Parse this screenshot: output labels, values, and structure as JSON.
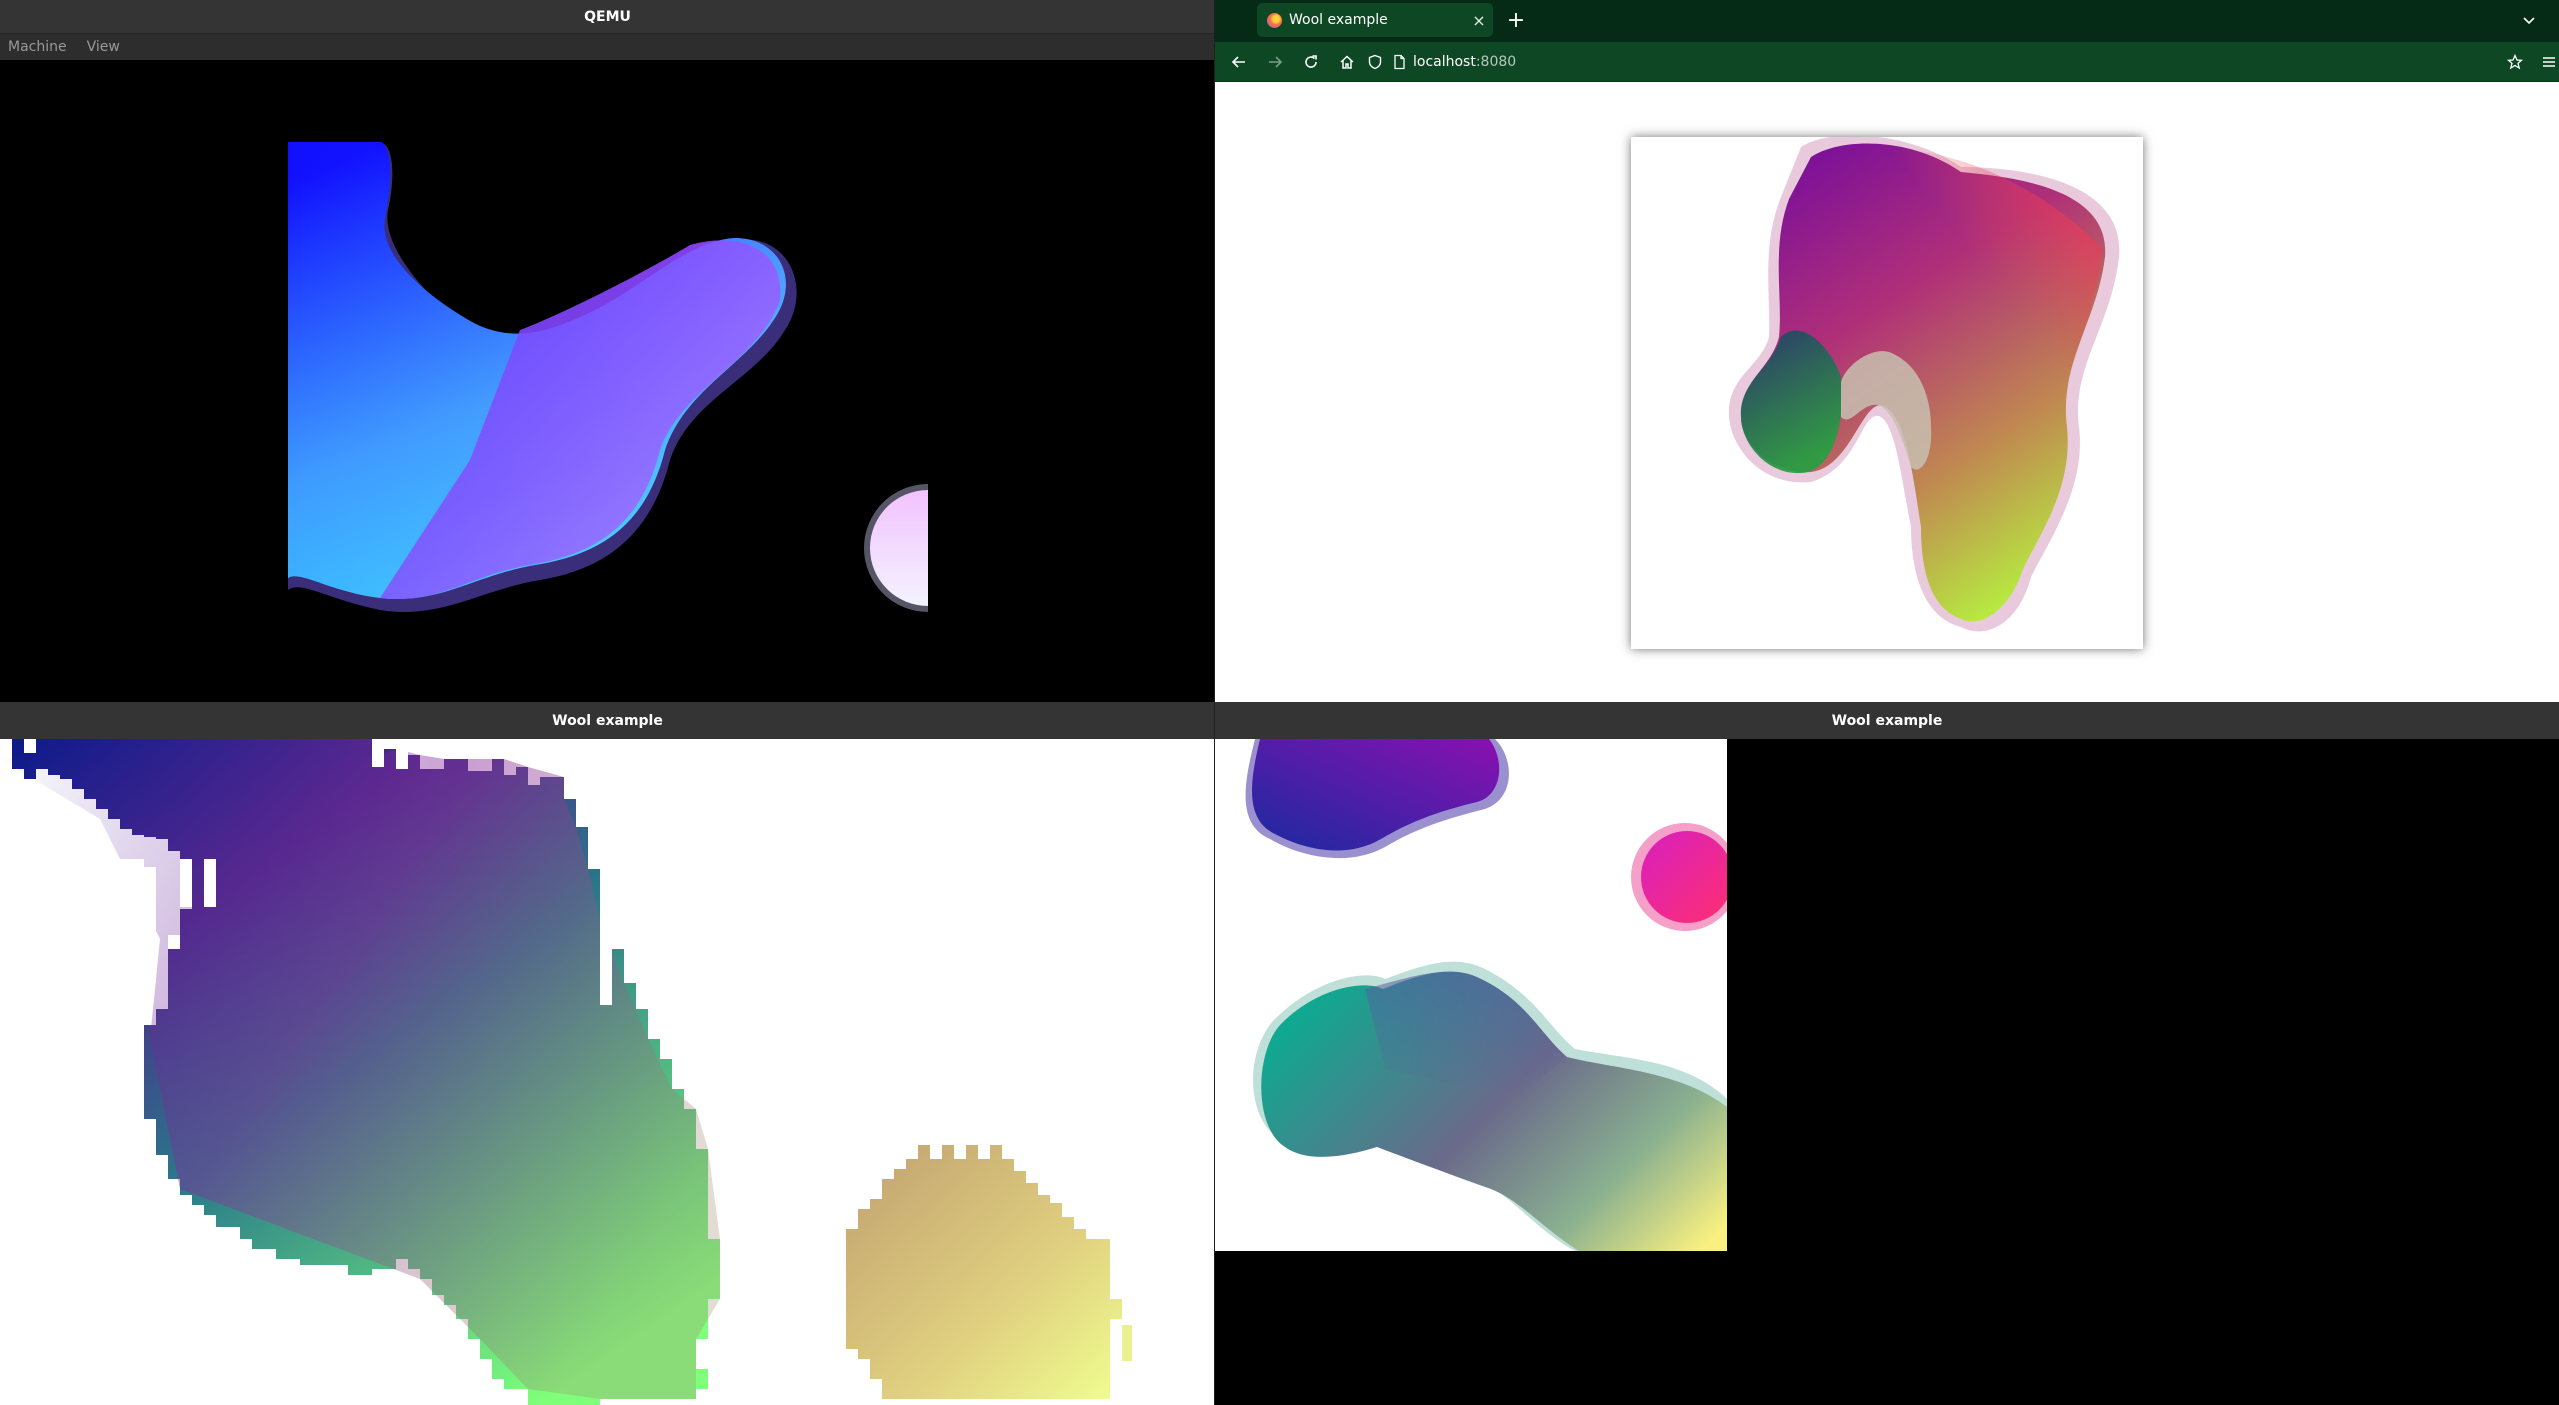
{
  "qemu_window": {
    "title": "QEMU",
    "menu": [
      "Machine",
      "View"
    ]
  },
  "browser_window": {
    "tab_title": "Wool example",
    "tab_close": "×",
    "new_tab": "+",
    "url_host": "localhost",
    "url_port": ":8080",
    "icons": {
      "back": "back-arrow-icon",
      "forward": "forward-arrow-icon",
      "reload": "reload-icon",
      "home": "home-icon",
      "tracking": "shield-icon",
      "page": "page-icon",
      "bookmark": "star-icon",
      "menu": "hamburger-menu-icon",
      "tab_list": "chevron-down-icon"
    },
    "accent_color": "#0d4724"
  },
  "bottom_left_window": {
    "title": "Wool example"
  },
  "bottom_right_window": {
    "title": "Wool example"
  }
}
